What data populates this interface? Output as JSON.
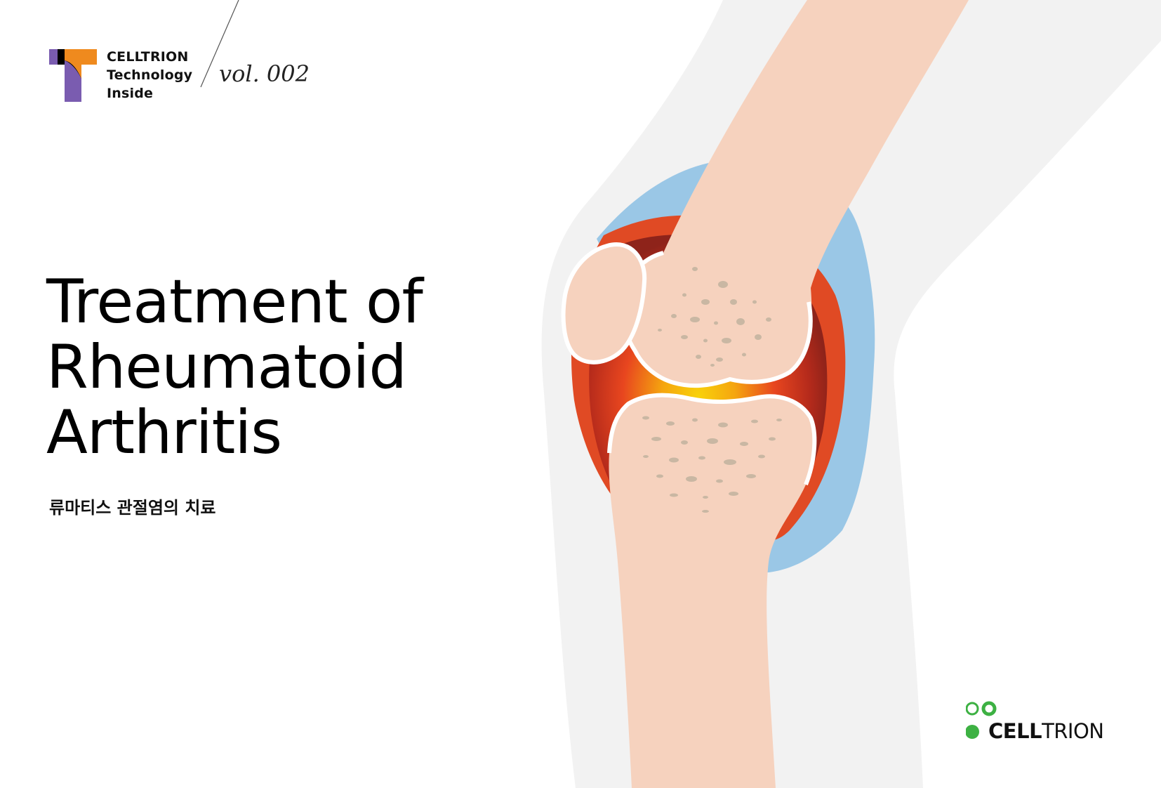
{
  "header": {
    "series_lines": [
      "CELLTRION",
      "Technology",
      "Inside"
    ],
    "volume": "vol. 002"
  },
  "cover": {
    "title_lines": [
      "Treatment of",
      "Rheumatoid",
      "Arthritis"
    ],
    "subtitle": "류마티스 관절염의 치료"
  },
  "brand": {
    "name_bold": "CELL",
    "name_light": "TRION",
    "accent_color": "#3db143"
  },
  "colors": {
    "leg": "#f2f2f2",
    "bone": "#f6d2be",
    "swelling": "#9ac7e6",
    "inflammation": "#e04a24",
    "hotspot": "#f8c90a",
    "bone_pores": "#c9b7a3",
    "logo_orange": "#ef8a1e",
    "logo_purple": "#7a5cb0"
  },
  "icons": [
    "knee-joint-illustration",
    "technology-inside-logo",
    "celltrion-logo"
  ]
}
